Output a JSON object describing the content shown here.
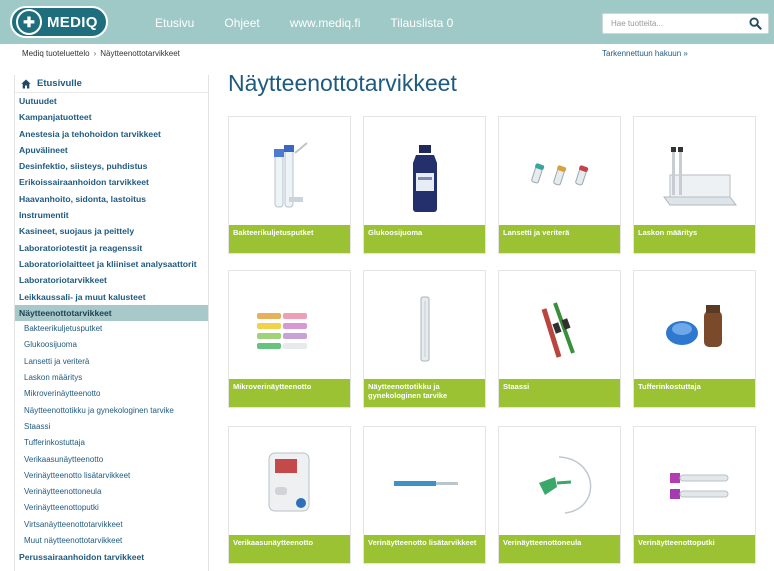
{
  "header": {
    "logo_text": "MEDIQ",
    "nav": [
      "Etusivu",
      "Ohjeet",
      "www.mediq.fi",
      "Tilauslista 0"
    ],
    "search_placeholder": "Hae tuotteita..."
  },
  "breadcrumb": {
    "items": [
      "Mediq tuoteluettelo",
      "Näytteenottotarvikkeet"
    ],
    "separator": "›"
  },
  "advanced_search": "Tarkennettuun hakuun »",
  "page_title": "Näytteenottotarvikkeet",
  "sidebar": {
    "home": "Etusivulle",
    "items_before": [
      "Uutuudet",
      "Kampanjatuotteet",
      "Anestesia ja tehohoidon tarvikkeet",
      "Apuvälineet",
      "Desinfektio, siisteys, puhdistus",
      "Erikoissairaanhoidon tarvikkeet",
      "Haavanhoito, sidonta, lastoitus",
      "Instrumentit",
      "Kasineet, suojaus ja peittely",
      "Laboratoriotestit ja reagenssit",
      "Laboratoriolaitteet ja kliiniset analysaattorit",
      "Laboratoriotarvikkeet",
      "Leikkaussali- ja muut kalusteet"
    ],
    "active": "Näytteenottotarvikkeet",
    "subitems": [
      "Bakteerikuljetusputket",
      "Glukoosijuoma",
      "Lansetti ja veriterä",
      "Laskon määritys",
      "Mikroverinäytteenotto",
      "Näytteenottotikku ja gynekologinen tarvike",
      "Staassi",
      "Tufferinkostuttaja",
      "Verikaasunäytteenotto",
      "Verinäytteenotto lisätarvikkeet",
      "Verinäytteenottoneula",
      "Verinäytteenottoputki",
      "Virtsanäytteenottotarvikkeet",
      "Muut näytteenottotarvikkeet"
    ],
    "items_after": [
      "Perussairaanhoidon tarvikkeet"
    ]
  },
  "products": [
    {
      "label": "Bakteerikuljetusputket",
      "icon": "swab-tubes-icon"
    },
    {
      "label": "Glukoosijuoma",
      "icon": "glucose-bottle-icon"
    },
    {
      "label": "Lansetti ja veriterä",
      "icon": "lancet-icon"
    },
    {
      "label": "Laskon määritys",
      "icon": "sed-rate-rack-icon"
    },
    {
      "label": "Mikroverinäytteenotto",
      "icon": "micro-tubes-icon"
    },
    {
      "label": "Näytteenottotikku ja gynekologinen tarvike",
      "icon": "sampling-stick-icon"
    },
    {
      "label": "Staassi",
      "icon": "tourniquet-icon"
    },
    {
      "label": "Tufferinkostuttaja",
      "icon": "swab-moistener-icon"
    },
    {
      "label": "Verikaasunäytteenotto",
      "icon": "blood-gas-analyzer-icon"
    },
    {
      "label": "Verinäytteenotto lisätarvikkeet",
      "icon": "needle-holder-icon"
    },
    {
      "label": "Verinäytteenottoneula",
      "icon": "butterfly-needle-icon"
    },
    {
      "label": "Verinäytteenottoputki",
      "icon": "blood-tubes-icon"
    }
  ],
  "colors": {
    "header_bg": "#9fc9c7",
    "brand": "#1f6e7d",
    "link": "#1f5a80",
    "label_green": "#9ac233",
    "active_bg": "#a7c9c9"
  }
}
